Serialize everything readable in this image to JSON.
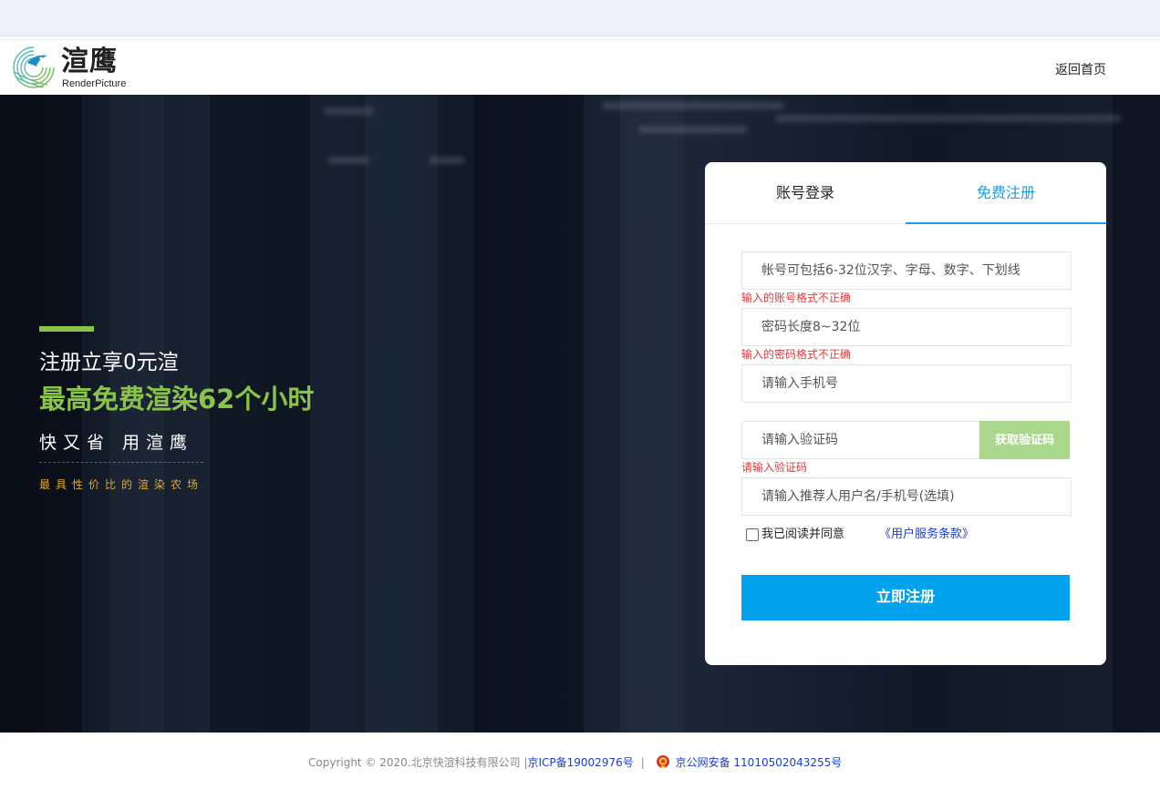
{
  "header": {
    "logo_cn": "渲鹰",
    "logo_en": "RenderPicture",
    "back_home": "返回首页"
  },
  "promo": {
    "line1": "注册立享0元渲",
    "line2": "最高免费渲染62个小时",
    "line3": "快又省  用渲鹰",
    "line4": "最具性价比的渲染农场"
  },
  "tabs": {
    "login": "账号登录",
    "register": "免费注册"
  },
  "form": {
    "account_placeholder": "帐号可包括6-32位汉字、字母、数字、下划线",
    "account_error": "输入的账号格式不正确",
    "password_placeholder": "密码长度8~32位",
    "password_error": "输入的密码格式不正确",
    "phone_placeholder": "请输入手机号",
    "code_placeholder": "请输入验证码",
    "code_button": "获取验证码",
    "code_error": "请输入验证码",
    "referrer_placeholder": "请输入推荐人用户名/手机号(选填)",
    "agree_text": "我已阅读并同意",
    "agree_link": "《用户服务条款》",
    "submit": "立即注册"
  },
  "footer": {
    "copyright": "Copyright © 2020.北京快渲科技有限公司 |",
    "icp": "京ICP备19002976号",
    "separator": "|",
    "police": "京公网安备 11010502043255号"
  },
  "colors": {
    "accent": "#03a2ec",
    "tab_active": "#1a9ee3",
    "promo_green": "#8bc34a",
    "promo_gold": "#e0a82e",
    "error_red": "#e03b3b",
    "code_button": "#a9d88c",
    "link_blue": "#1b3fd6"
  }
}
